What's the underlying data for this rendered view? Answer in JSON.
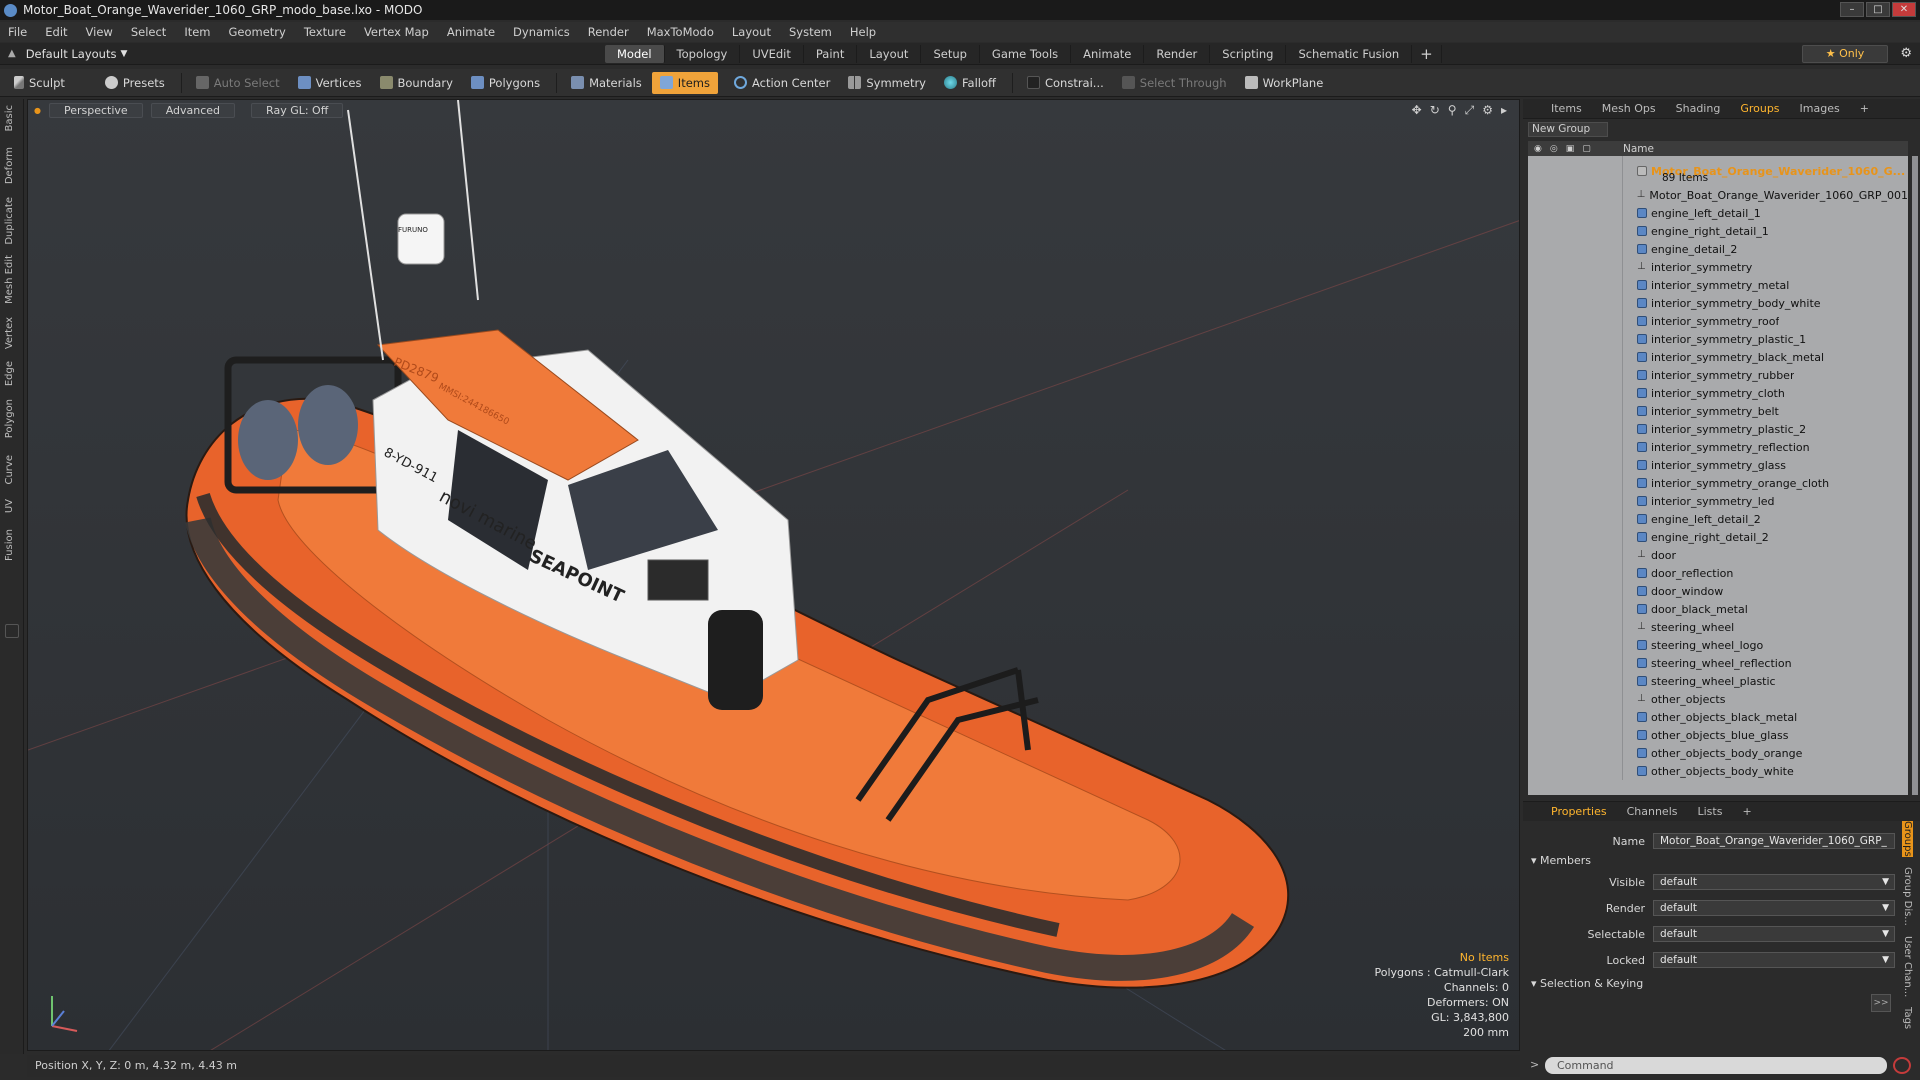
{
  "window": {
    "title": "Motor_Boat_Orange_Waverider_1060_GRP_modo_base.lxo - MODO",
    "controls": [
      "–",
      "□",
      "✕"
    ]
  },
  "menu": [
    "File",
    "Edit",
    "View",
    "Select",
    "Item",
    "Geometry",
    "Texture",
    "Vertex Map",
    "Animate",
    "Dynamics",
    "Render",
    "MaxToModo",
    "Layout",
    "System",
    "Help"
  ],
  "layouts": {
    "label": "Default Layouts"
  },
  "mode_tabs": [
    "Model",
    "Topology",
    "UVEdit",
    "Paint",
    "Layout",
    "Setup",
    "Game Tools",
    "Animate",
    "Render",
    "Scripting",
    "Schematic Fusion"
  ],
  "only_button": "Only",
  "toolbar": {
    "sculpt": "Sculpt",
    "presets": "Presets",
    "auto_select": "Auto Select",
    "vertices": "Vertices",
    "boundary": "Boundary",
    "polygons": "Polygons",
    "materials": "Materials",
    "items": "Items",
    "action_center": "Action Center",
    "symmetry": "Symmetry",
    "falloff": "Falloff",
    "constraints": "Constrai...",
    "select_through": "Select Through",
    "workplane": "WorkPlane"
  },
  "left_tabs": [
    "Basic",
    "Deform",
    "Duplicate",
    "Mesh Edit",
    "Vertex",
    "Edge",
    "Polygon",
    "Curve",
    "UV",
    "Fusion"
  ],
  "viewport": {
    "projection": "Perspective",
    "shading": "Advanced",
    "raygl": "Ray GL: Off",
    "info": {
      "selection": "No Items",
      "polygons": "Polygons : Catmull-Clark",
      "channels": "Channels: 0",
      "deformers": "Deformers: ON",
      "gl": "GL: 3,843,800",
      "scale": "200 mm"
    },
    "hull_text": {
      "id": "PD2879",
      "mmsi": "MMSI:244186650",
      "reg": "8-YD-911",
      "brand": "novi marine",
      "name": "SEAPOINT",
      "radar": "FURUNO"
    }
  },
  "right_panel": {
    "tabs": [
      "Items",
      "Mesh Ops",
      "Shading",
      "Groups",
      "Images"
    ],
    "active_tab": "Groups",
    "new_group": "New Group",
    "name_header": "Name",
    "group": {
      "name": "Motor_Boat_Orange_Waverider_1060_G...",
      "count": "89 Items"
    },
    "items": [
      {
        "name": "Motor_Boat_Orange_Waverider_1060_GRP_001",
        "type": "locator"
      },
      {
        "name": "engine_left_detail_1",
        "type": "mesh"
      },
      {
        "name": "engine_right_detail_1",
        "type": "mesh"
      },
      {
        "name": "engine_detail_2",
        "type": "mesh"
      },
      {
        "name": "interior_symmetry",
        "type": "locator"
      },
      {
        "name": "interior_symmetry_metal",
        "type": "mesh"
      },
      {
        "name": "interior_symmetry_body_white",
        "type": "mesh"
      },
      {
        "name": "interior_symmetry_roof",
        "type": "mesh"
      },
      {
        "name": "interior_symmetry_plastic_1",
        "type": "mesh"
      },
      {
        "name": "interior_symmetry_black_metal",
        "type": "mesh"
      },
      {
        "name": "interior_symmetry_rubber",
        "type": "mesh"
      },
      {
        "name": "interior_symmetry_cloth",
        "type": "mesh"
      },
      {
        "name": "interior_symmetry_belt",
        "type": "mesh"
      },
      {
        "name": "interior_symmetry_plastic_2",
        "type": "mesh"
      },
      {
        "name": "interior_symmetry_reflection",
        "type": "mesh"
      },
      {
        "name": "interior_symmetry_glass",
        "type": "mesh"
      },
      {
        "name": "interior_symmetry_orange_cloth",
        "type": "mesh"
      },
      {
        "name": "interior_symmetry_led",
        "type": "mesh"
      },
      {
        "name": "engine_left_detail_2",
        "type": "mesh"
      },
      {
        "name": "engine_right_detail_2",
        "type": "mesh"
      },
      {
        "name": "door",
        "type": "locator"
      },
      {
        "name": "door_reflection",
        "type": "mesh"
      },
      {
        "name": "door_window",
        "type": "mesh"
      },
      {
        "name": "door_black_metal",
        "type": "mesh"
      },
      {
        "name": "steering_wheel",
        "type": "locator"
      },
      {
        "name": "steering_wheel_logo",
        "type": "mesh"
      },
      {
        "name": "steering_wheel_reflection",
        "type": "mesh"
      },
      {
        "name": "steering_wheel_plastic",
        "type": "mesh"
      },
      {
        "name": "other_objects",
        "type": "locator"
      },
      {
        "name": "other_objects_black_metal",
        "type": "mesh"
      },
      {
        "name": "other_objects_blue_glass",
        "type": "mesh"
      },
      {
        "name": "other_objects_body_orange",
        "type": "mesh"
      },
      {
        "name": "other_objects_body_white",
        "type": "mesh"
      }
    ],
    "props_tabs": [
      "Properties",
      "Channels",
      "Lists"
    ],
    "props": {
      "name_label": "Name",
      "name_value": "Motor_Boat_Orange_Waverider_1060_GRP_",
      "members": "Members",
      "visible_label": "Visible",
      "visible": "default",
      "render_label": "Render",
      "render": "default",
      "selectable_label": "Selectable",
      "selectable": "default",
      "locked_label": "Locked",
      "locked": "default",
      "selection_keying": "Selection & Keying"
    },
    "side_tabs": [
      "Groups",
      "Group Dis...",
      "User Chan...",
      "Tags"
    ]
  },
  "status": {
    "position": "Position X, Y, Z:  0 m, 4.32 m, 4.43 m"
  },
  "command": {
    "placeholder": "Command"
  },
  "colors": {
    "accent": "#e8941a",
    "items_active": "#f0a33a",
    "hull_orange": "#e8632b",
    "bg": "#2b2b2b"
  }
}
